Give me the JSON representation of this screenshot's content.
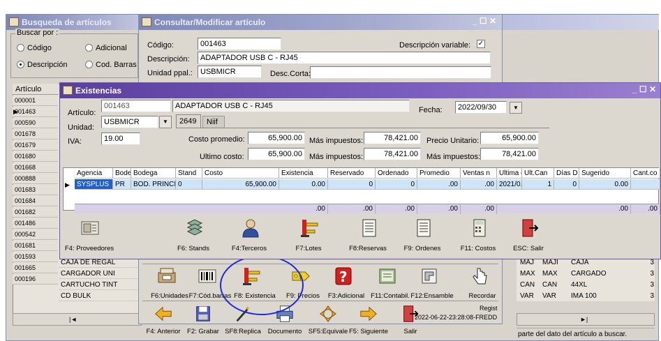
{
  "busqueda": {
    "title": "Busqueda de artículos",
    "buscar_por": "Buscar por :",
    "radios": [
      {
        "label": "Código",
        "checked": false
      },
      {
        "label": "Adicional",
        "checked": false
      },
      {
        "label": "Descripción",
        "checked": true
      },
      {
        "label": "Cod. Barras",
        "checked": false
      }
    ],
    "col_articulo": "Artículo",
    "codes": [
      "000001",
      "001463",
      "000590",
      "001678",
      "001679",
      "001680",
      "001668",
      "000888",
      "001683",
      "001684",
      "001682",
      "001486",
      "000542",
      "001681",
      "001593",
      "001665",
      "000196"
    ],
    "rows_desc": [
      {
        "code": "001681",
        "desc": "CAJA DE REGAL"
      },
      {
        "code": "001593",
        "desc": "CARGADOR UNI"
      },
      {
        "code": "001665",
        "desc": "CARTUCHO TINT"
      },
      {
        "code": "000196",
        "desc": "CD BULK"
      }
    ],
    "right_rows": [
      {
        "a": "MAJ",
        "b": "MAJI",
        "c": "CAJA",
        "d": "3"
      },
      {
        "a": "MAX",
        "b": "MAX",
        "c": "CARGADO",
        "d": "3"
      },
      {
        "a": "CAN",
        "b": "CAN",
        "c": "44XL",
        "d": "3"
      },
      {
        "a": "VAR",
        "b": "VAR",
        "c": "IMA 100",
        "d": "3"
      }
    ],
    "nav_first": "|◄",
    "nav_last": "►|",
    "status_hint": "parte del dato del artículo a buscar."
  },
  "consultar": {
    "title": "Consultar/Modificar artículo",
    "codigo_label": "Código:",
    "codigo": "001463",
    "desc_label": "Descripción:",
    "descripcion": "ADAPTADOR USB C - RJ45",
    "unidad_label": "Unidad ppal.:",
    "unidad": "USBMICR",
    "desc_corta_label": "Desc.Corta:",
    "desc_var_label": "Descripción variable:",
    "desc_var_checked": true,
    "toolbar1": [
      {
        "label": "F6:Unidades",
        "icon": "register-icon"
      },
      {
        "label": "F7:Cód.barras",
        "icon": "barcode-icon"
      },
      {
        "label": "F8: Existencia",
        "icon": "forklift-icon"
      },
      {
        "label": "F9: Precios",
        "icon": "price-tag-icon"
      },
      {
        "label": "F3:Adicional",
        "icon": "question-icon"
      },
      {
        "label": "F11:Contabil.",
        "icon": "ledger-icon"
      },
      {
        "label": "F12:Ensamble",
        "icon": "assembly-icon"
      },
      {
        "label": "Recordar",
        "icon": "hand-icon"
      }
    ],
    "toolbar2": [
      {
        "label": "F4: Anterior",
        "icon": "arrow-left-icon"
      },
      {
        "label": "F2: Grabar",
        "icon": "save-icon"
      },
      {
        "label": "SF8:Replica",
        "icon": "wand-icon"
      },
      {
        "label": "Documento",
        "icon": "printer-icon"
      },
      {
        "label": "SF5:Equivale",
        "icon": "equivalence-icon"
      },
      {
        "label": "F5: Siguiente",
        "icon": "arrow-right-icon"
      },
      {
        "label": "Salir",
        "icon": "exit-icon"
      }
    ],
    "registro_label": "Regist",
    "registro_value": "2022-06-22-23:28:08-FREDD"
  },
  "existencias": {
    "title": "Existencias",
    "articulo_label": "Artículo:",
    "articulo": "001463",
    "descripcion": "ADAPTADOR USB C - RJ45",
    "fecha_label": "Fecha:",
    "fecha": "2022/09/30",
    "unidad_label": "Unidad:",
    "unidad": "USBMICR",
    "iva_label": "IVA:",
    "iva": "19.00",
    "tabs": [
      "2649",
      "Niif"
    ],
    "costo_promedio_label": "Costo promedio:",
    "costo_promedio": "65,900.00",
    "mas_impuestos_label": "Más impuestos:",
    "costo_prom_imp": "78,421.00",
    "precio_unitario_label": "Precio Unitario:",
    "precio_unitario": "65,900.00",
    "ultimo_costo_label": "Ultimo costo:",
    "ultimo_costo": "65,900.00",
    "ultimo_costo_imp": "78,421.00",
    "precio_imp": "78,421.00",
    "columns": [
      "Agencia",
      "Bode",
      "Bodega",
      "Stand",
      "Costo",
      "Existencia",
      "Reservado",
      "Ordenado",
      "Promedio",
      "Ventas n",
      "Ultima c",
      "Ult.Can",
      "Días D",
      "Sugerido",
      "Cant.co"
    ],
    "row": [
      "SYSPLUS",
      "PR",
      "BOD. PRINCIPAL",
      "0",
      "65,900.00",
      "0.00",
      "0",
      "0",
      ".00",
      ".00",
      "2021/0...",
      "1",
      "0",
      "0.00",
      ""
    ],
    "totals": {
      "existencia": ".00",
      "reservado": ".00",
      "ordenado": ".00",
      "promedio": ".00",
      "ventas": ".00",
      "sugerido": ".00",
      "cant": ".00"
    },
    "toolbar": [
      {
        "label": "F4: Proveedores",
        "icon": "suppliers-icon"
      },
      {
        "label": "F6: Stands",
        "icon": "stands-icon"
      },
      {
        "label": "F4:Terceros",
        "icon": "person-icon"
      },
      {
        "label": "F7:Lotes",
        "icon": "forklift-icon"
      },
      {
        "label": "F8:Reservas",
        "icon": "document-icon"
      },
      {
        "label": "F9: Ordenes",
        "icon": "document-icon"
      },
      {
        "label": "F11: Costos",
        "icon": "calculator-icon"
      },
      {
        "label": "ESC: Salir",
        "icon": "exit-icon"
      }
    ]
  }
}
